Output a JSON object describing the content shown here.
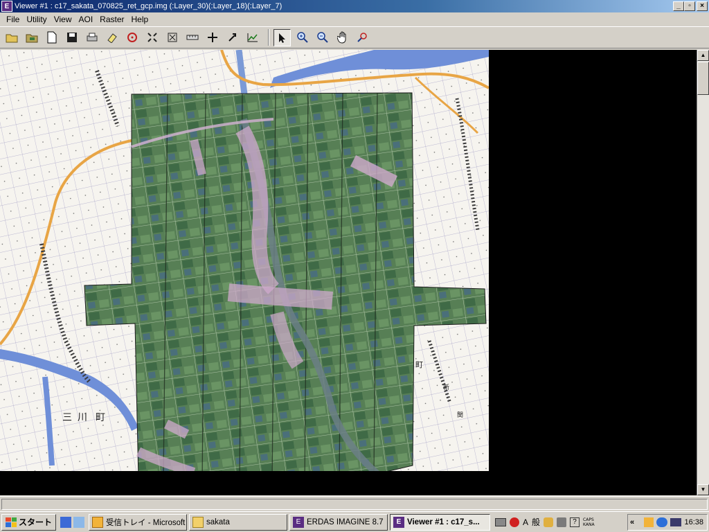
{
  "window": {
    "title": "Viewer #1 : c17_sakata_070825_ret_gcp.img (:Layer_30)(:Layer_18)(:Layer_7)",
    "app_icon_letter": "E",
    "minimize_glyph": "_",
    "maximize_glyph": "▫",
    "close_glyph": "×"
  },
  "menu": {
    "file": "File",
    "utility": "Utility",
    "view": "View",
    "aoi": "AOI",
    "raster": "Raster",
    "help": "Help"
  },
  "toolbar": {
    "icons": [
      "open-folder-icon",
      "open-layer-icon",
      "new-document-icon",
      "save-icon",
      "print-icon",
      "erase-icon",
      "inquire-cursor-icon",
      "fit-extent-icon",
      "scale-icon",
      "measure-ruler-icon",
      "crosshair-icon",
      "link-icon",
      "histogram-icon",
      "select-arrow-icon",
      "zoom-in-icon",
      "zoom-out-icon",
      "pan-hand-icon",
      "roam-icon"
    ]
  },
  "map": {
    "place_labels": [
      "三",
      "川",
      "町",
      "町",
      "新",
      "関"
    ],
    "colors": {
      "land": "#f6f4ef",
      "imagery_base": "#4f7a52",
      "river": "#6f8fd8",
      "main_road": "#e8a545",
      "contour": "#6b5a3c",
      "urban": "#c9a7c9"
    }
  },
  "taskbar": {
    "start_label": "スタート",
    "tasks": [
      {
        "label": "受信トレイ - Microsoft ...",
        "icon": "outlook-icon"
      },
      {
        "label": "sakata",
        "icon": "folder-icon"
      },
      {
        "label": "ERDAS IMAGINE 8.7",
        "icon": "erdas-icon"
      },
      {
        "label": "Viewer #1 : c17_s...",
        "icon": "viewer-icon"
      }
    ],
    "ime": {
      "mode": "A",
      "kanji": "般",
      "caps": "CAPS",
      "kana": "KANA"
    },
    "clock": "16:38",
    "tray_chevron": "«"
  }
}
